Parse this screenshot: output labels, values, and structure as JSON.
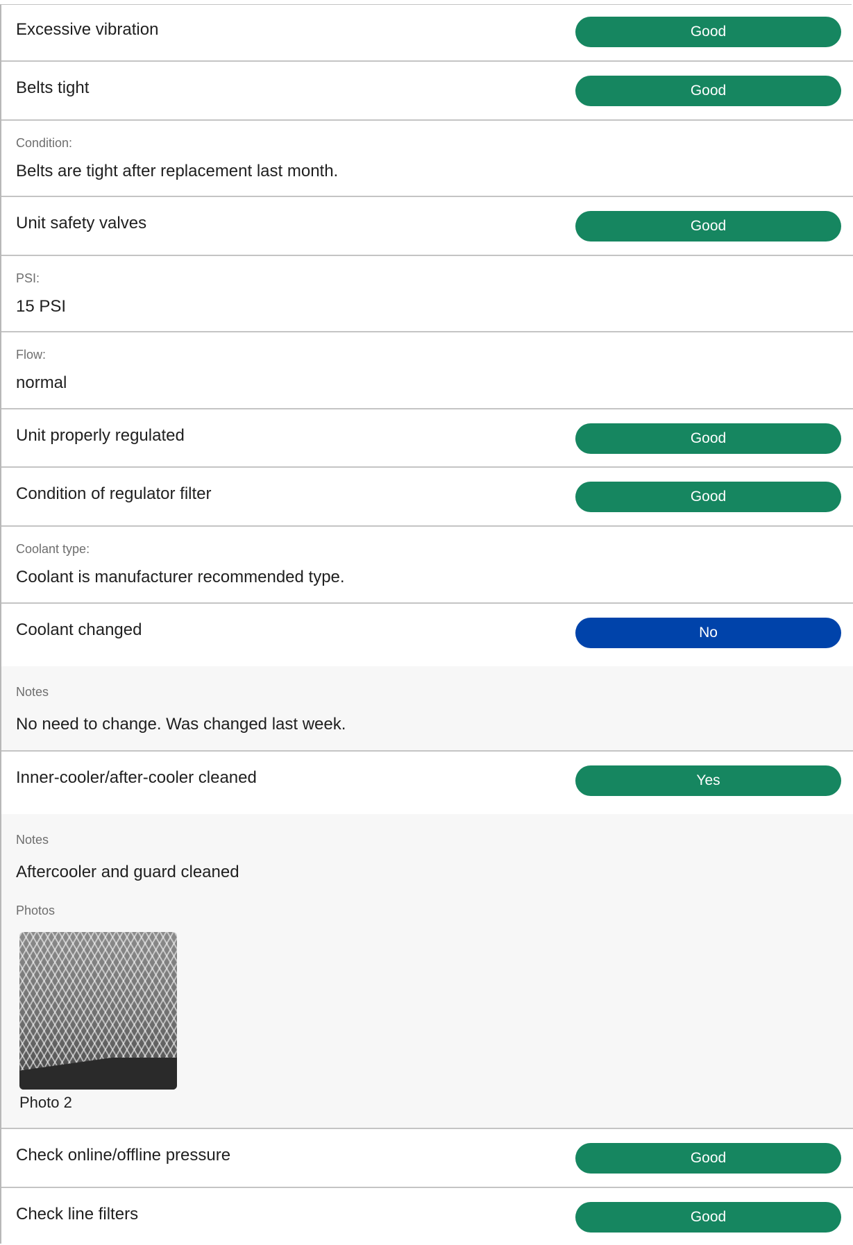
{
  "items": [
    {
      "label": "Excessive vibration",
      "status": "Good"
    },
    {
      "label": "Belts tight",
      "status": "Good"
    },
    {
      "field_label": "Condition:",
      "field_value": "Belts are tight after replacement last month."
    },
    {
      "label": "Unit safety valves",
      "status": "Good"
    },
    {
      "field_label": "PSI:",
      "field_value": "15 PSI"
    },
    {
      "field_label": "Flow:",
      "field_value": "normal"
    },
    {
      "label": "Unit properly regulated",
      "status": "Good"
    },
    {
      "label": "Condition of regulator filter",
      "status": "Good"
    },
    {
      "field_label": "Coolant type:",
      "field_value": "Coolant is manufacturer recommended type."
    },
    {
      "label": "Coolant changed",
      "status": "No",
      "notes_label": "Notes",
      "notes": "No need to change. Was changed last week."
    },
    {
      "label": "Inner-cooler/after-cooler cleaned",
      "status": "Yes",
      "notes_label": "Notes",
      "notes": "Aftercooler and guard cleaned",
      "photos_label": "Photos",
      "photo_caption": "Photo 2"
    },
    {
      "label": "Check online/offline pressure",
      "status": "Good"
    },
    {
      "label": "Check line filters",
      "status": "Good"
    }
  ],
  "colors": {
    "good": "#168660",
    "no": "#0043aa",
    "yes": "#168660"
  }
}
